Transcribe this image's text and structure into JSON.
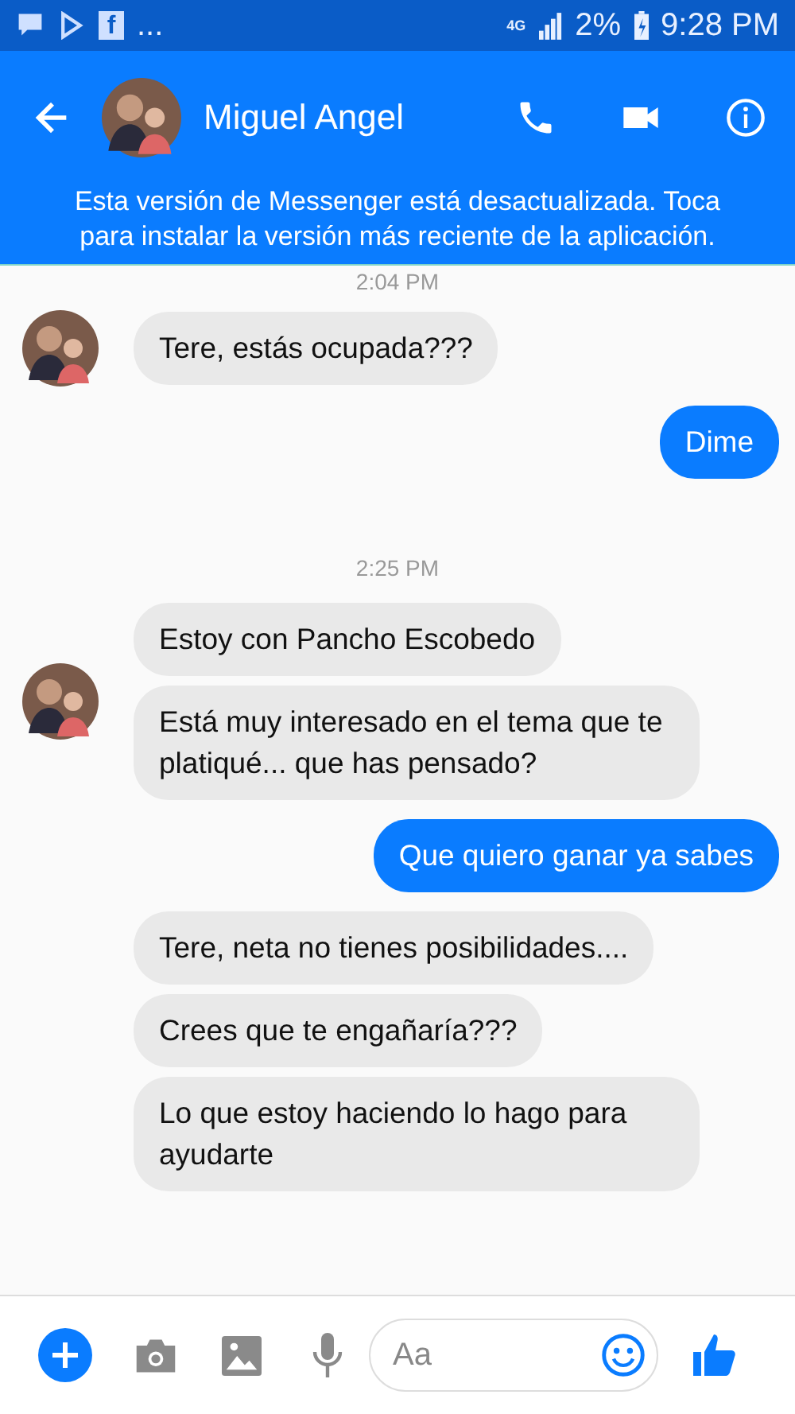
{
  "status_bar": {
    "app_badge": "f",
    "more": "...",
    "network": "4G",
    "battery": "2%",
    "time": "9:28 PM"
  },
  "header": {
    "contact_name": "Miguel Angel"
  },
  "update_banner": {
    "text": "Esta versión de Messenger está desactualizada. Toca para instalar la versión más reciente de la aplicación."
  },
  "chat": [
    {
      "kind": "time",
      "text": "2:04 PM"
    },
    {
      "kind": "incoming",
      "avatar": true,
      "messages": [
        "Tere, estás ocupada???"
      ]
    },
    {
      "kind": "outgoing",
      "messages": [
        "Dime"
      ]
    },
    {
      "kind": "time",
      "text": "2:25 PM"
    },
    {
      "kind": "incoming",
      "avatar": true,
      "messages": [
        "Estoy con Pancho Escobedo",
        "Está muy interesado en el tema que te platiqué... que has pensado?"
      ]
    },
    {
      "kind": "outgoing",
      "messages": [
        "Que quiero ganar ya sabes"
      ]
    },
    {
      "kind": "incoming",
      "avatar": false,
      "messages": [
        "Tere, neta no tienes posibilidades....",
        "Crees que te engañaría???",
        "Lo que estoy haciendo lo hago para ayudarte"
      ]
    }
  ],
  "composer": {
    "placeholder": "Aa"
  }
}
